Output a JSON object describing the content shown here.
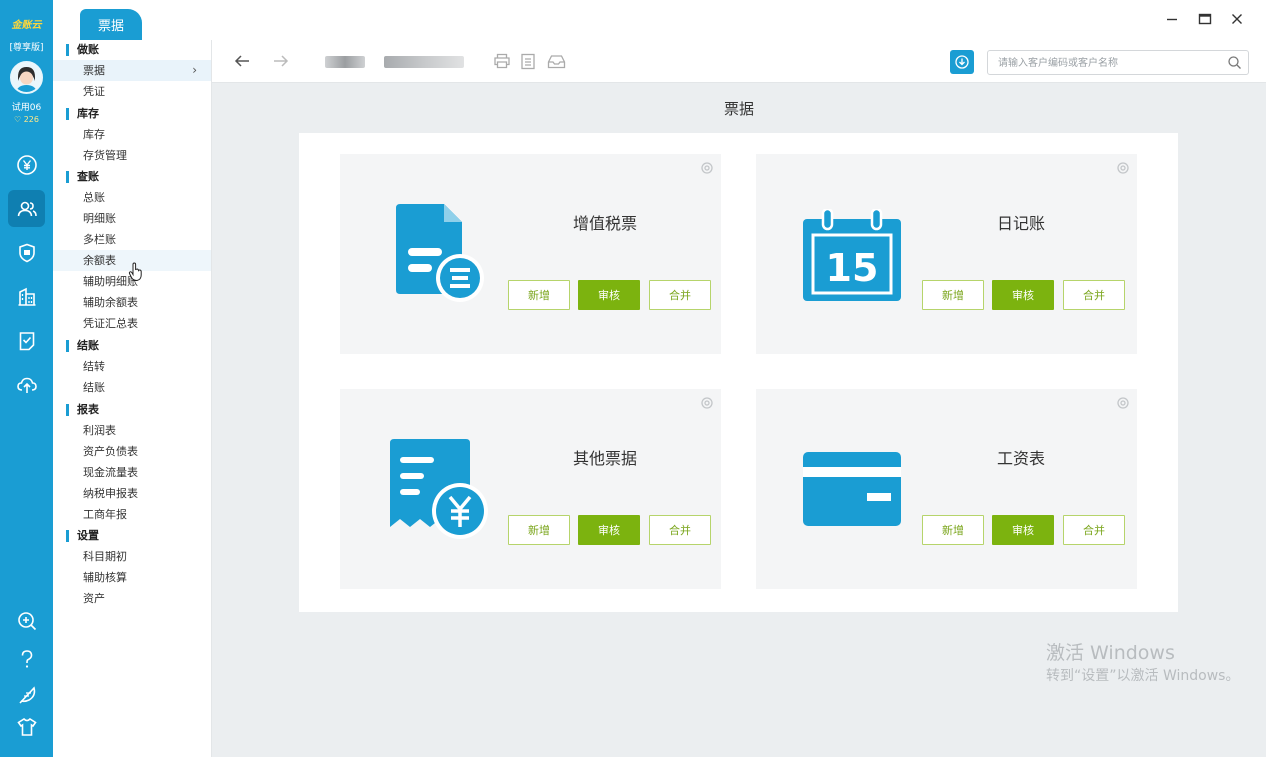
{
  "app": {
    "logo_text": "金账云",
    "edition": "[尊享版]",
    "username": "试用06",
    "points": "226"
  },
  "rail_icons": [
    {
      "name": "yuan-icon"
    },
    {
      "name": "users-icon"
    },
    {
      "name": "shield-icon"
    },
    {
      "name": "building-icon"
    },
    {
      "name": "document-check-icon"
    },
    {
      "name": "cloud-upload-icon"
    },
    {
      "name": "zoom-in-icon"
    },
    {
      "name": "help-icon"
    },
    {
      "name": "feather-icon"
    },
    {
      "name": "shirt-icon"
    }
  ],
  "tabs": [
    {
      "label": "票据"
    }
  ],
  "nav": {
    "groups": [
      {
        "label": "做账",
        "items": [
          {
            "label": "票据"
          },
          {
            "label": "凭证"
          }
        ]
      },
      {
        "label": "库存",
        "items": [
          {
            "label": "库存"
          },
          {
            "label": "存货管理"
          }
        ]
      },
      {
        "label": "查账",
        "items": [
          {
            "label": "总账"
          },
          {
            "label": "明细账"
          },
          {
            "label": "多栏账"
          },
          {
            "label": "余额表"
          },
          {
            "label": "辅助明细账"
          },
          {
            "label": "辅助余额表"
          },
          {
            "label": "凭证汇总表"
          }
        ]
      },
      {
        "label": "结账",
        "items": [
          {
            "label": "结转"
          },
          {
            "label": "结账"
          }
        ]
      },
      {
        "label": "报表",
        "items": [
          {
            "label": "利润表"
          },
          {
            "label": "资产负债表"
          },
          {
            "label": "现金流量表"
          },
          {
            "label": "纳税申报表"
          },
          {
            "label": "工商年报"
          }
        ]
      },
      {
        "label": "设置",
        "items": [
          {
            "label": "科目期初"
          },
          {
            "label": "辅助核算"
          },
          {
            "label": "资产"
          }
        ]
      }
    ]
  },
  "toolbar": {
    "search_placeholder": "请输入客户编码或客户名称"
  },
  "page": {
    "title": "票据",
    "cards": [
      {
        "title": "增值税票",
        "buttons": [
          "新增",
          "审核",
          "合并"
        ],
        "icon": "invoice-icon"
      },
      {
        "title": "日记账",
        "buttons": [
          "新增",
          "审核",
          "合并"
        ],
        "icon": "calendar-icon",
        "calendar_day": "15"
      },
      {
        "title": "其他票据",
        "buttons": [
          "新增",
          "审核",
          "合并"
        ],
        "icon": "receipt-yuan-icon"
      },
      {
        "title": "工资表",
        "buttons": [
          "新增",
          "审核",
          "合并"
        ],
        "icon": "card-icon"
      }
    ]
  },
  "watermark": {
    "line1": "激活 Windows",
    "line2": "转到“设置”以激活 Windows。"
  },
  "colors": {
    "brand": "#1a9dd3",
    "accent_green": "#7cb30f",
    "background": "#ebeef0"
  }
}
